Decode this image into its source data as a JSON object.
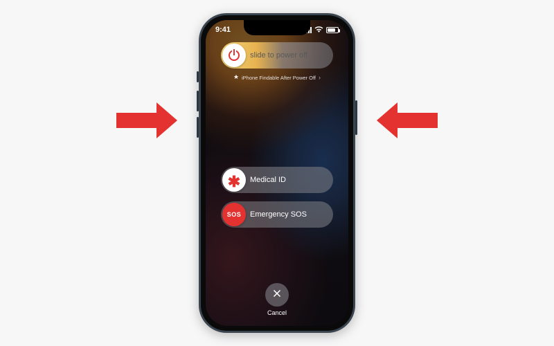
{
  "status": {
    "time": "9:41"
  },
  "power_slider": {
    "label": "slide to power off"
  },
  "findable": {
    "text": "iPhone Findable After Power Off"
  },
  "medical": {
    "label": "Medical ID"
  },
  "sos": {
    "knob": "SOS",
    "label": "Emergency SOS"
  },
  "cancel": {
    "label": "Cancel"
  }
}
